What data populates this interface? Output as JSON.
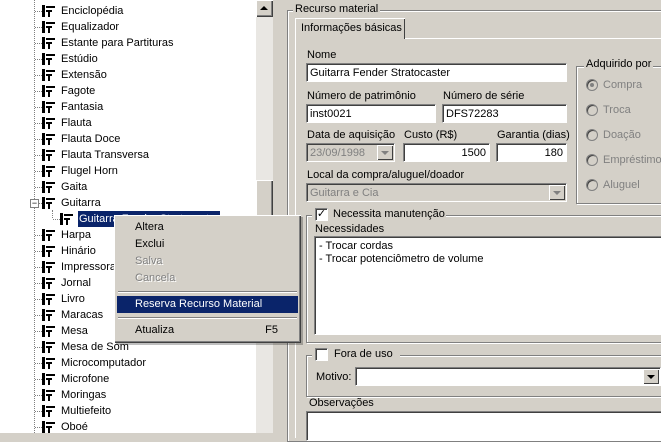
{
  "tree": {
    "items": [
      {
        "label": "Enciclopédia"
      },
      {
        "label": "Equalizador"
      },
      {
        "label": "Estante para Partituras"
      },
      {
        "label": "Estúdio"
      },
      {
        "label": "Extensão"
      },
      {
        "label": "Fagote"
      },
      {
        "label": "Fantasia"
      },
      {
        "label": "Flauta"
      },
      {
        "label": "Flauta Doce"
      },
      {
        "label": "Flauta Transversa"
      },
      {
        "label": "Flugel Horn"
      },
      {
        "label": "Gaita"
      },
      {
        "label": "Guitarra",
        "expander": "−"
      },
      {
        "label": "Guitarra Fender Stratocaster",
        "selected": true
      },
      {
        "label": "Harpa"
      },
      {
        "label": "Hinário"
      },
      {
        "label": "Impressora"
      },
      {
        "label": "Jornal"
      },
      {
        "label": "Livro"
      },
      {
        "label": "Maracas"
      },
      {
        "label": "Mesa"
      },
      {
        "label": "Mesa de Som"
      },
      {
        "label": "Microcomputador"
      },
      {
        "label": "Microfone"
      },
      {
        "label": "Moringas"
      },
      {
        "label": "Multiefeito"
      },
      {
        "label": "Oboé"
      }
    ]
  },
  "context_menu": {
    "items": [
      {
        "label": "Altera",
        "enabled": true
      },
      {
        "label": "Exclui",
        "enabled": true
      },
      {
        "label": "Salva",
        "enabled": false
      },
      {
        "label": "Cancela",
        "enabled": false
      },
      {
        "label": "Reserva Recurso Material",
        "enabled": true,
        "highlighted": true
      },
      {
        "label": "Atualiza",
        "shortcut": "F5",
        "enabled": true
      }
    ]
  },
  "panel": {
    "group_title": "Recurso material",
    "tab_label": "Informações básicas",
    "nome_label": "Nome",
    "nome_value": "Guitarra Fender Stratocaster",
    "patrimonio_label": "Número de patrimônio",
    "patrimonio_value": "inst0021",
    "serie_label": "Número de série",
    "serie_value": "DFS72283",
    "data_aquisicao_label": "Data de aquisição",
    "data_aquisicao_value": "23/09/1998",
    "custo_label": "Custo (R$)",
    "custo_value": "1500",
    "garantia_label": "Garantia (dias)",
    "garantia_value": "180",
    "local_label": "Local da compra/aluguel/doador",
    "local_value": "Guitarra e Cia",
    "adquirido_title": "Adquirido por",
    "adquirido_options": [
      "Compra",
      "Troca",
      "Doação",
      "Empréstimo",
      "Aluguel"
    ],
    "adquirido_selected": "Compra",
    "manutencao_label": "Necessita manutenção",
    "manutencao_checked": true,
    "necessidades_label": "Necessidades",
    "necessidades_lines": [
      "- Trocar cordas",
      "- Trocar potenciômetro de volume"
    ],
    "fora_uso_label": "Fora de uso",
    "fora_uso_checked": false,
    "motivo_label": "Motivo:",
    "motivo_value": "",
    "observacoes_label": "Observações"
  }
}
